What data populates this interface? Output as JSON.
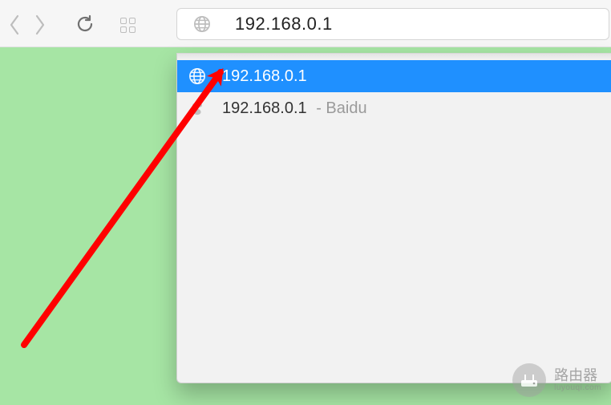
{
  "toolbar": {
    "address_text": "192.168.0.1"
  },
  "suggestions": [
    {
      "text": "192.168.0.1",
      "suffix": "",
      "icon": "globe",
      "selected": true
    },
    {
      "text": "192.168.0.1",
      "suffix": " - Baidu",
      "icon": "baidu",
      "selected": false
    }
  ],
  "watermark": {
    "title": "路由器",
    "subtitle": "luyouqi.com"
  }
}
